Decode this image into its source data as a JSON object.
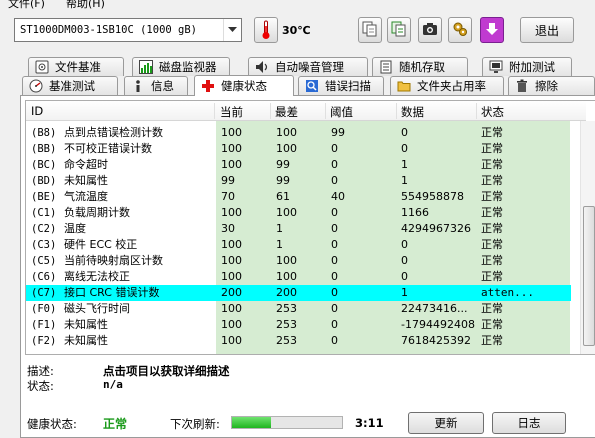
{
  "menubar": {
    "items": [
      "文件(F)",
      "帮助(H)"
    ]
  },
  "toolbar": {
    "drive": "ST1000DM003-1SB10C (1000 gB)",
    "temperature": "30℃",
    "exit_label": "退出"
  },
  "tabs_row1": [
    {
      "label": "文件基准",
      "icon": "disk-icon"
    },
    {
      "label": "磁盘监视器",
      "icon": "chart-icon"
    },
    {
      "label": "自动噪音管理",
      "icon": "speaker-icon"
    },
    {
      "label": "随机存取",
      "icon": "document-icon"
    },
    {
      "label": "附加测试",
      "icon": "monitor-icon"
    }
  ],
  "tabs_row2": [
    {
      "label": "基准测试",
      "icon": "gauge-icon"
    },
    {
      "label": "信息",
      "icon": "info-icon"
    },
    {
      "label": "健康状态",
      "icon": "health-cross-icon",
      "active": true
    },
    {
      "label": "错误扫描",
      "icon": "search-icon"
    },
    {
      "label": "文件夹占用率",
      "icon": "folder-icon"
    },
    {
      "label": "擦除",
      "icon": "trash-icon"
    }
  ],
  "table": {
    "columns": [
      "ID",
      "当前",
      "最差",
      "阈值",
      "数据",
      "状态"
    ],
    "rows": [
      {
        "id": "(B8)",
        "name": "点到点错误检测计数",
        "current": "100",
        "worst": "100",
        "threshold": "99",
        "data": "0",
        "status": "正常"
      },
      {
        "id": "(BB)",
        "name": "不可校正错误计数",
        "current": "100",
        "worst": "100",
        "threshold": "0",
        "data": "0",
        "status": "正常"
      },
      {
        "id": "(BC)",
        "name": "命令超时",
        "current": "100",
        "worst": "99",
        "threshold": "0",
        "data": "1",
        "status": "正常"
      },
      {
        "id": "(BD)",
        "name": "未知属性",
        "current": "99",
        "worst": "99",
        "threshold": "0",
        "data": "1",
        "status": "正常"
      },
      {
        "id": "(BE)",
        "name": "气流温度",
        "current": "70",
        "worst": "61",
        "threshold": "40",
        "data": "554958878",
        "status": "正常"
      },
      {
        "id": "(C1)",
        "name": "负载周期计数",
        "current": "100",
        "worst": "100",
        "threshold": "0",
        "data": "1166",
        "status": "正常"
      },
      {
        "id": "(C2)",
        "name": "温度",
        "current": "30",
        "worst": "1",
        "threshold": "0",
        "data": "4294967326",
        "status": "正常"
      },
      {
        "id": "(C3)",
        "name": "硬件 ECC 校正",
        "current": "100",
        "worst": "1",
        "threshold": "0",
        "data": "0",
        "status": "正常"
      },
      {
        "id": "(C5)",
        "name": "当前待映射扇区计数",
        "current": "100",
        "worst": "100",
        "threshold": "0",
        "data": "0",
        "status": "正常"
      },
      {
        "id": "(C6)",
        "name": "离线无法校正",
        "current": "100",
        "worst": "100",
        "threshold": "0",
        "data": "0",
        "status": "正常"
      },
      {
        "id": "(C7)",
        "name": "接口 CRC 错误计数",
        "current": "200",
        "worst": "200",
        "threshold": "0",
        "data": "1",
        "status": "atten...",
        "selected": true
      },
      {
        "id": "(F0)",
        "name": "磁头飞行时间",
        "current": "100",
        "worst": "253",
        "threshold": "0",
        "data": "22473416...",
        "status": "正常"
      },
      {
        "id": "(F1)",
        "name": "未知属性",
        "current": "100",
        "worst": "253",
        "threshold": "0",
        "data": "-1794492408",
        "status": "正常"
      },
      {
        "id": "(F2)",
        "name": "未知属性",
        "current": "100",
        "worst": "253",
        "threshold": "0",
        "data": "7618425392",
        "status": "正常"
      }
    ]
  },
  "details": {
    "desc_label": "描述:",
    "desc_value": "点击项目以获取详细描述",
    "state_label": "状态:",
    "state_value": "n/a"
  },
  "footer": {
    "health_label": "健康状态:",
    "health_value": "正常",
    "health_color": "#1a9a1a",
    "refresh_label": "下次刷新:",
    "refresh_progress_percent": 35,
    "refresh_time": "3:11",
    "update_label": "更新",
    "log_label": "日志"
  }
}
